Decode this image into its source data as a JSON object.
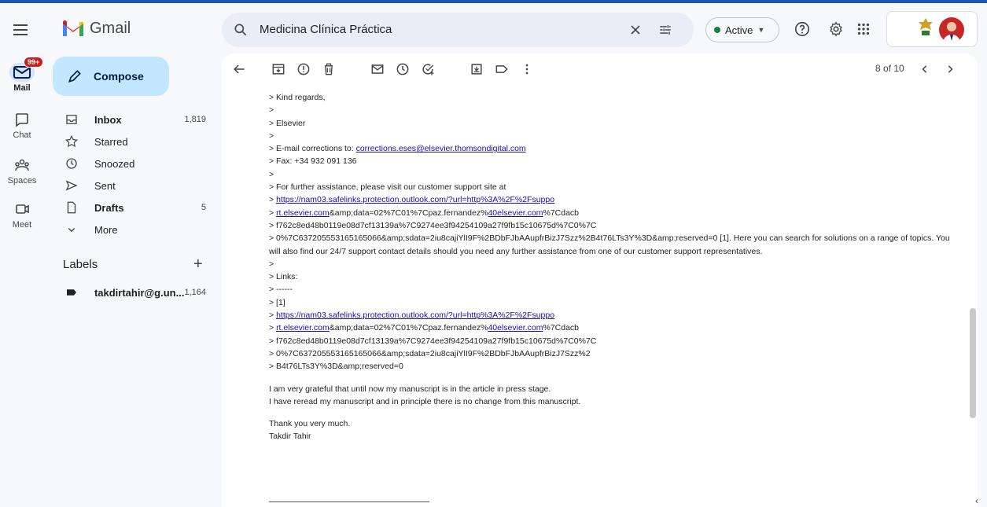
{
  "rail": {
    "mail_label": "Mail",
    "mail_badge": "99+",
    "chat_label": "Chat",
    "spaces_label": "Spaces",
    "meet_label": "Meet"
  },
  "brand": {
    "name": "Gmail"
  },
  "search": {
    "query": "Medicina Clínica Práctica"
  },
  "status": {
    "label": "Active"
  },
  "compose": {
    "label": "Compose"
  },
  "nav": [
    {
      "label": "Inbox",
      "count": "1,819",
      "bold": true
    },
    {
      "label": "Starred",
      "count": ""
    },
    {
      "label": "Snoozed",
      "count": ""
    },
    {
      "label": "Sent",
      "count": ""
    },
    {
      "label": "Drafts",
      "count": "5",
      "bold": true
    },
    {
      "label": "More",
      "count": ""
    }
  ],
  "labels": {
    "header": "Labels",
    "items": [
      {
        "label": "takdirtahir@g.un...",
        "count": "1,164"
      }
    ]
  },
  "pager": {
    "text": "8 of 10"
  },
  "email": {
    "l1": "> Kind regards,",
    "l2": ">",
    "l3": "> Elsevier",
    "l4": ">",
    "l5_pre": "> E-mail corrections to: ",
    "l5_link": "corrections.eses@elsevier.thomsondigital.com",
    "l6": ">  Fax: +34 932 091 136",
    "l7": ">",
    "l8": "> For further assistance, please visit our customer support site at",
    "l9_pre": "> ",
    "l9_link": "https://nam03.safelinks.protection.outlook.com/?url=http%3A%2F%2Fsuppo",
    "l10_pre": "> ",
    "l10_link1": "rt.elsevier.com",
    "l10_mid": "&amp;data=02%7C01%7Cpaz.fernandez%",
    "l10_link2": "40elsevier.com",
    "l10_post": "%7Cdacb",
    "l11": "> f762c8ed48b0119e08d7cf13139a%7C9274ee3f94254109a27f9fb15c10675d%7C0%7C",
    "l12": "> 0%7C637205553165165066&amp;sdata=2iu8cajiYlI9F%2BDbFJbAAupfrBizJ7Szz%2B4t76LTs3Y%3D&amp;reserved=0 [1]. Here you can search for solutions on a range of topics. You will also find our 24/7 support contact details should you need any further assistance from one of our customer support representatives.",
    "l13": ">",
    "l14": "> Links:",
    "l15": "> ------",
    "l16": "> [1]",
    "l17_pre": "> ",
    "l17_link": "https://nam03.safelinks.protection.outlook.com/?url=http%3A%2F%2Fsuppo",
    "l18_pre": "> ",
    "l18_link1": "rt.elsevier.com",
    "l18_mid": "&amp;data=02%7C01%7Cpaz.fernandez%",
    "l18_link2": "40elsevier.com",
    "l18_post": "%7Cdacb",
    "l19": "> f762c8ed48b0119e08d7cf13139a%7C9274ee3f94254109a27f9fb15c10675d%7C0%7C",
    "l20": "> 0%7C637205553165165066&amp;sdata=2iu8cajiYlI9F%2BDbFJbAAupfrBizJ7Szz%2",
    "l21": "> B4t76LTs3Y%3D&amp;reserved=0",
    "p1": "I am very grateful that until now my manuscript is in the article in press stage.",
    "p2": "I have reread my manuscript and in principle there is no change from this manuscript.",
    "p3": "Thank you very much.",
    "p4": "Takdir Tahir"
  },
  "colors": {
    "accent": "#c2e7ff",
    "badge": "#c5221f",
    "active": "#188038",
    "link": "#1a0dab"
  }
}
